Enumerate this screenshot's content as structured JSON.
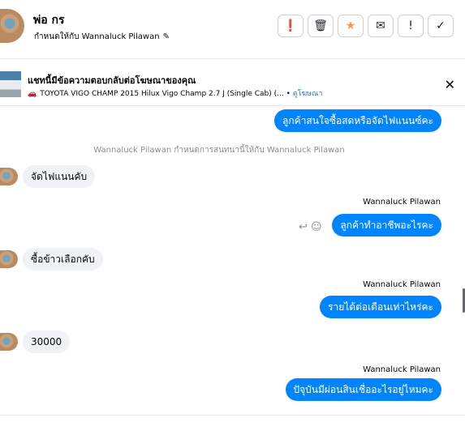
{
  "header": {
    "name": "พ่อ กร",
    "assigned_to": "กำหนดให้กับ Wannaluck Pilawan",
    "actions": [
      {
        "icon": "alert-circle-icon",
        "glyph": "❗"
      },
      {
        "icon": "trash-icon",
        "glyph": "🗑"
      },
      {
        "icon": "star-icon",
        "glyph": "★"
      },
      {
        "icon": "mail-icon",
        "glyph": "✉"
      },
      {
        "icon": "exclamation-icon",
        "glyph": "!"
      },
      {
        "icon": "check-icon",
        "glyph": "✓"
      }
    ]
  },
  "ad": {
    "title": "แชทนี้มีข้อความตอบกลับต่อโฆษณาของคุณ",
    "subtitle": "TOYOTA VIGO CHAMP 2015 Hilux Vigo Champ 2.7 J (Single Cab) (...",
    "link": "ดูโฆษณา"
  },
  "messages": {
    "m1": "ลูกค้าสนใจซื้อสดหรือจัดไฟแนนซ์คะ",
    "system": "Wannaluck Pilawan กำหนดการสนทนานี้ให้กับ Wannaluck Pilawan",
    "m2": "จัดไฟแนนคับ",
    "sender1": "Wannaluck Pilawan",
    "m3": "ลูกค้าทำอาชีพอะไรคะ",
    "m4": "ซื้อข้าวเลือกคับ",
    "sender2": "Wannaluck Pilawan",
    "m5": "รายได้ต่อเดือนเท่าไหร่คะ",
    "m6": "30000",
    "sender3": "Wannaluck Pilawan",
    "m7": "ปัจุบันมีผ่อนสินเชื่ออะไรอยู่ไหมคะ"
  },
  "colors": {
    "accent": "#0084ff",
    "incoming_bubble": "#f0f2f5",
    "star": "#f2994a"
  }
}
